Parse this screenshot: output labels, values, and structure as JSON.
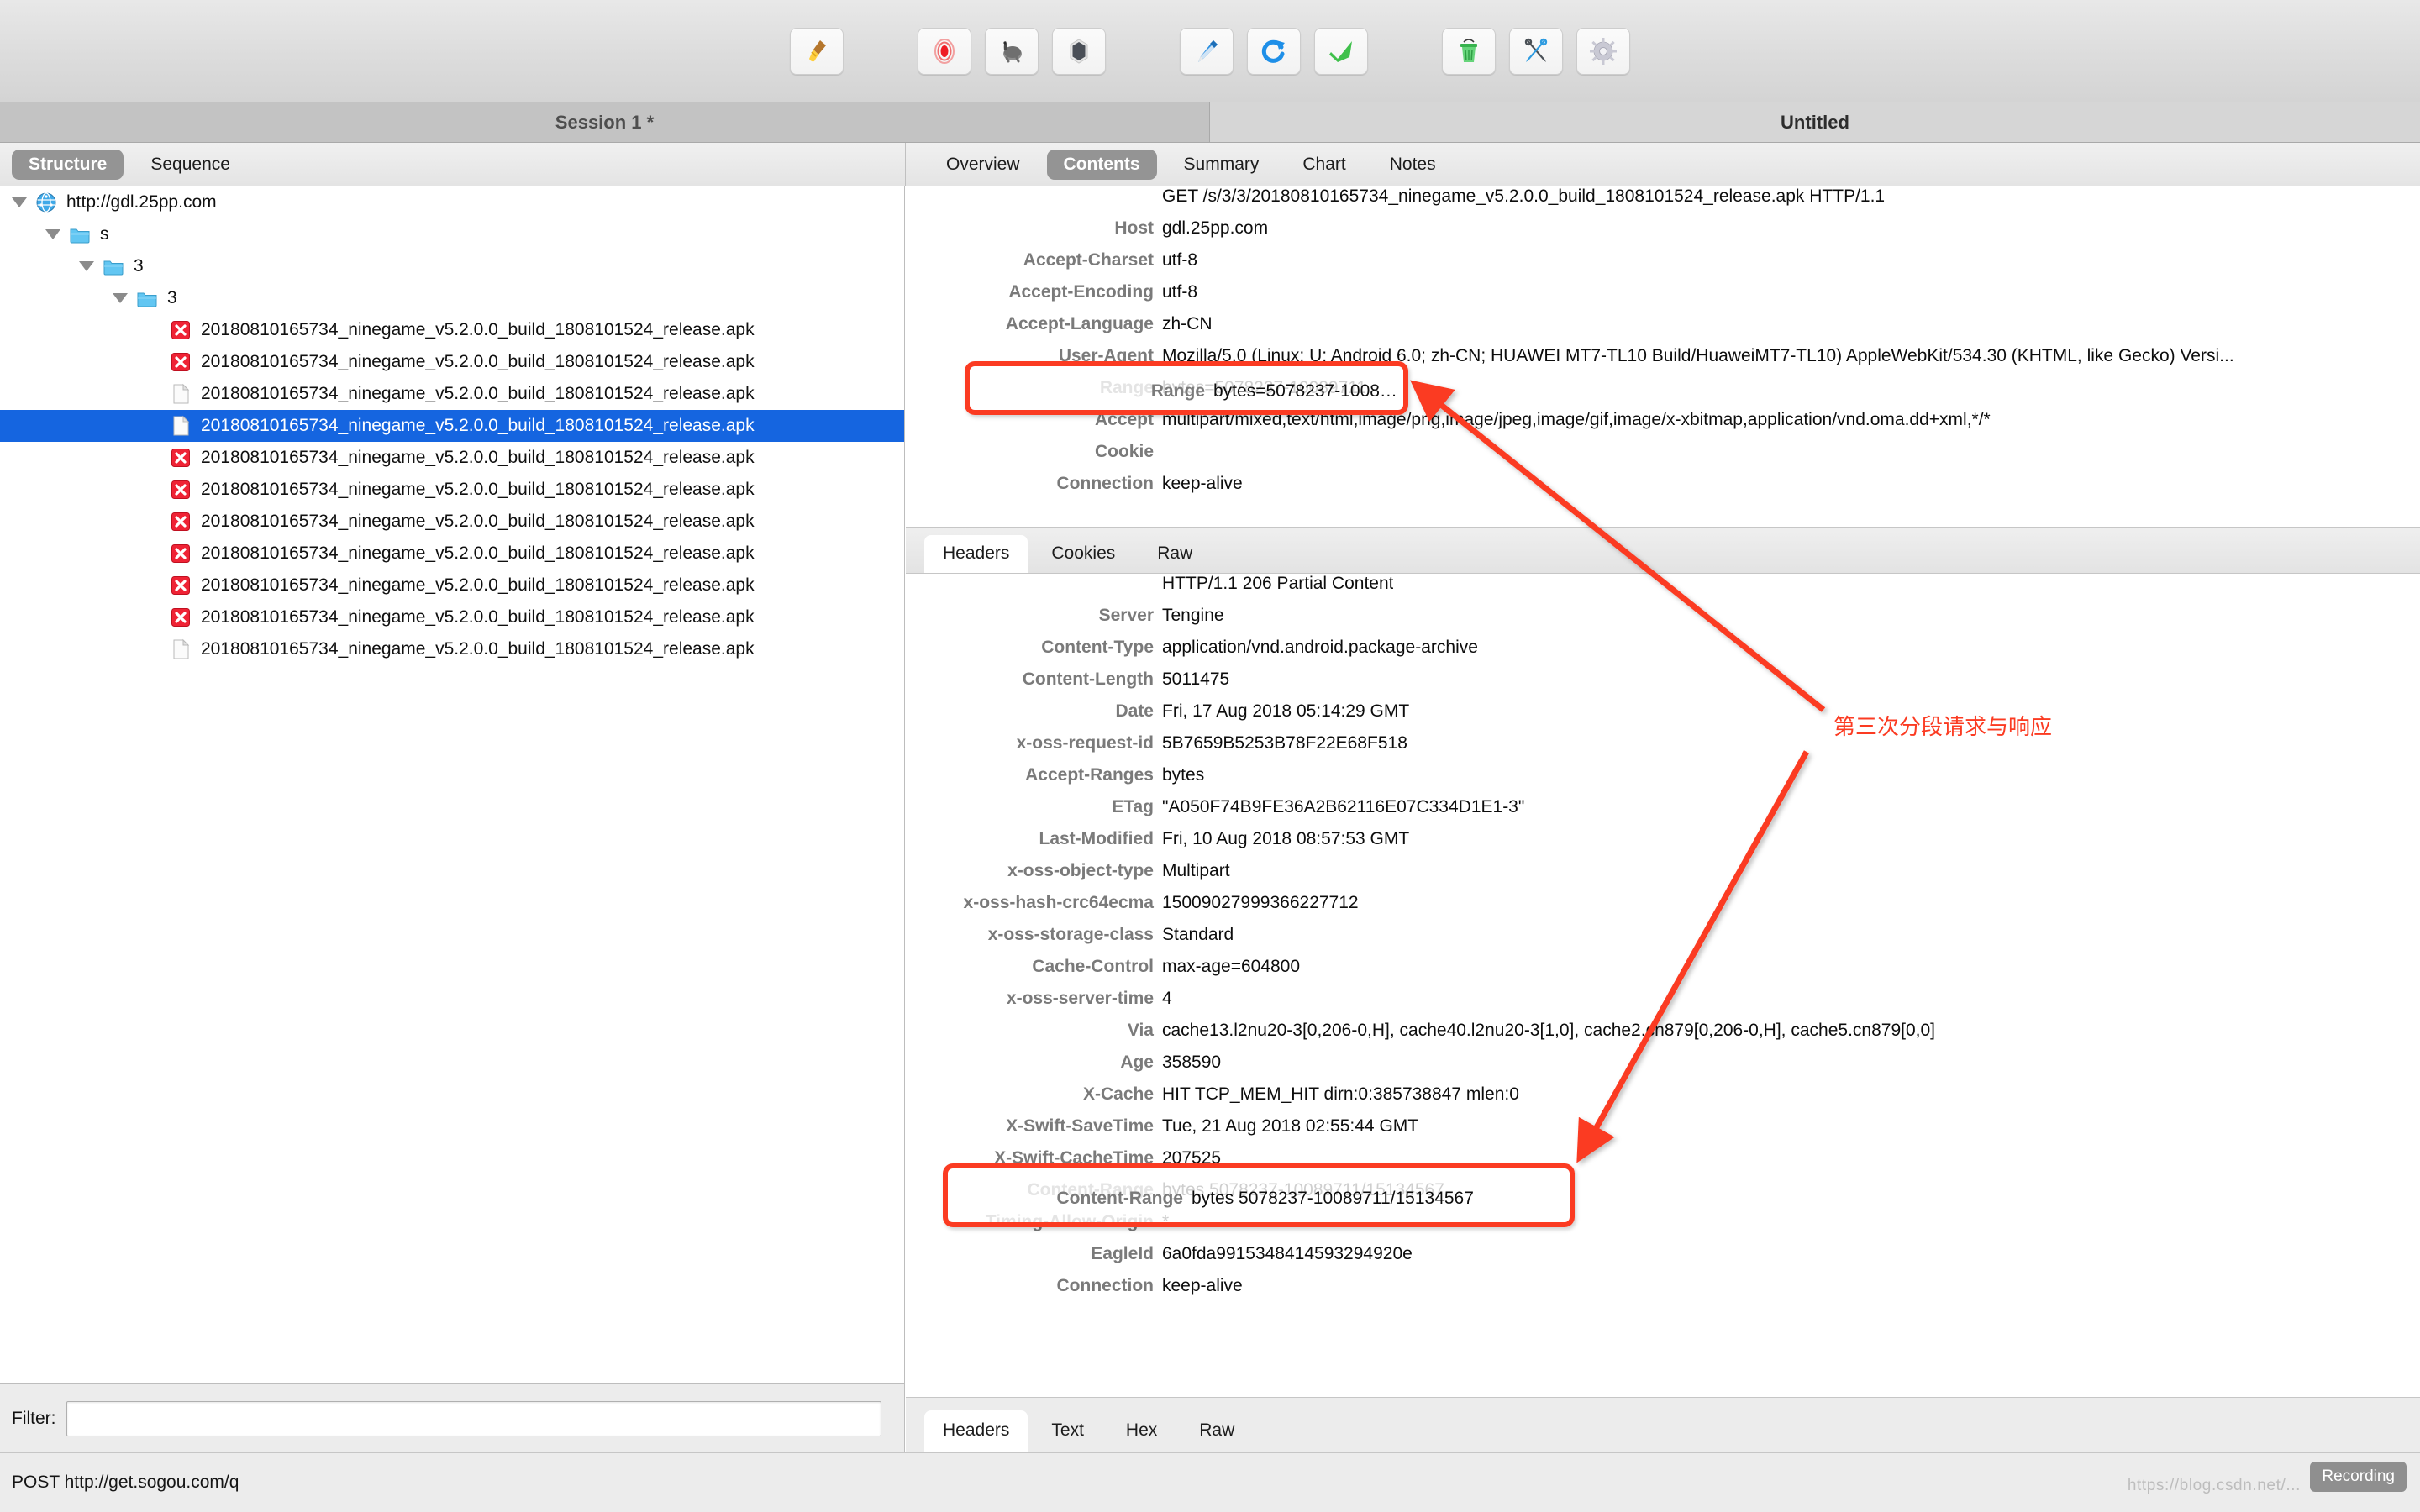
{
  "toolbar": {
    "buttons": [
      {
        "name": "clear-session-button",
        "icon": "broom-icon",
        "label": "Clear"
      },
      {
        "name": "record-button",
        "icon": "record-icon",
        "label": "Start/Stop Recording"
      },
      {
        "name": "throttle-button",
        "icon": "turtle-icon",
        "label": "Throttle"
      },
      {
        "name": "breakpoints-button",
        "icon": "shield-icon",
        "label": "Breakpoints"
      },
      {
        "name": "compose-button",
        "icon": "pen-icon",
        "label": "Compose"
      },
      {
        "name": "repeat-button",
        "icon": "repeat-icon",
        "label": "Repeat"
      },
      {
        "name": "validate-button",
        "icon": "checkmark-icon",
        "label": "Validate"
      },
      {
        "name": "trash-button",
        "icon": "trash-icon",
        "label": "Delete"
      },
      {
        "name": "tools-button",
        "icon": "tools-icon",
        "label": "Tools"
      },
      {
        "name": "settings-button",
        "icon": "gear-icon",
        "label": "Settings"
      }
    ]
  },
  "session": {
    "left_title": "Session 1 *",
    "right_title": "Untitled"
  },
  "left_tabs": [
    {
      "label": "Structure",
      "active": true
    },
    {
      "label": "Sequence",
      "active": false
    }
  ],
  "right_tabs": [
    {
      "label": "Overview",
      "active": false
    },
    {
      "label": "Contents",
      "active": true
    },
    {
      "label": "Summary",
      "active": false
    },
    {
      "label": "Chart",
      "active": false
    },
    {
      "label": "Notes",
      "active": false
    }
  ],
  "tree": {
    "apk_name": "20180810165734_ninegame_v5.2.0.0_build_1808101524_release.apk",
    "rows": [
      {
        "indent": 0,
        "twisty": true,
        "icon": "globe-icon",
        "label": "http://gdl.25pp.com",
        "selected": false
      },
      {
        "indent": 1,
        "twisty": true,
        "icon": "folder-icon",
        "label": "s",
        "selected": false
      },
      {
        "indent": 2,
        "twisty": true,
        "icon": "folder-icon",
        "label": "3",
        "selected": false
      },
      {
        "indent": 3,
        "twisty": true,
        "icon": "folder-icon",
        "label": "3",
        "selected": false
      },
      {
        "indent": 4,
        "twisty": false,
        "icon": "error-icon",
        "label": "20180810165734_ninegame_v5.2.0.0_build_1808101524_release.apk",
        "selected": false
      },
      {
        "indent": 4,
        "twisty": false,
        "icon": "error-icon",
        "label": "20180810165734_ninegame_v5.2.0.0_build_1808101524_release.apk",
        "selected": false
      },
      {
        "indent": 4,
        "twisty": false,
        "icon": "file-icon",
        "label": "20180810165734_ninegame_v5.2.0.0_build_1808101524_release.apk",
        "selected": false
      },
      {
        "indent": 4,
        "twisty": false,
        "icon": "file-icon",
        "label": "20180810165734_ninegame_v5.2.0.0_build_1808101524_release.apk",
        "selected": true
      },
      {
        "indent": 4,
        "twisty": false,
        "icon": "error-icon",
        "label": "20180810165734_ninegame_v5.2.0.0_build_1808101524_release.apk",
        "selected": false
      },
      {
        "indent": 4,
        "twisty": false,
        "icon": "error-icon",
        "label": "20180810165734_ninegame_v5.2.0.0_build_1808101524_release.apk",
        "selected": false
      },
      {
        "indent": 4,
        "twisty": false,
        "icon": "error-icon",
        "label": "20180810165734_ninegame_v5.2.0.0_build_1808101524_release.apk",
        "selected": false
      },
      {
        "indent": 4,
        "twisty": false,
        "icon": "error-icon",
        "label": "20180810165734_ninegame_v5.2.0.0_build_1808101524_release.apk",
        "selected": false
      },
      {
        "indent": 4,
        "twisty": false,
        "icon": "error-icon",
        "label": "20180810165734_ninegame_v5.2.0.0_build_1808101524_release.apk",
        "selected": false
      },
      {
        "indent": 4,
        "twisty": false,
        "icon": "error-icon",
        "label": "20180810165734_ninegame_v5.2.0.0_build_1808101524_release.apk",
        "selected": false
      },
      {
        "indent": 4,
        "twisty": false,
        "icon": "file-icon",
        "label": "20180810165734_ninegame_v5.2.0.0_build_1808101524_release.apk",
        "selected": false
      }
    ]
  },
  "filter": {
    "label": "Filter:",
    "value": "",
    "placeholder": ""
  },
  "request": {
    "request_line": "GET /s/3/3/20180810165734_ninegame_v5.2.0.0_build_1808101524_release.apk HTTP/1.1",
    "headers": [
      {
        "name": "Host",
        "value": "gdl.25pp.com"
      },
      {
        "name": "Accept-Charset",
        "value": "utf-8"
      },
      {
        "name": "Accept-Encoding",
        "value": "utf-8"
      },
      {
        "name": "Accept-Language",
        "value": "zh-CN"
      },
      {
        "name": "User-Agent",
        "value": "Mozilla/5.0 (Linux; U; Android 6.0; zh-CN; HUAWEI MT7-TL10 Build/HuaweiMT7-TL10) AppleWebKit/534.30 (KHTML, like Gecko) Versi..."
      },
      {
        "name": "Range",
        "value": "bytes=5078237-10089711"
      },
      {
        "name": "Accept",
        "value": "multipart/mixed,text/html,image/png,image/jpeg,image/gif,image/x-xbitmap,application/vnd.oma.dd+xml,*/*"
      },
      {
        "name": "Cookie",
        "value": ""
      },
      {
        "name": "Connection",
        "value": "keep-alive"
      }
    ]
  },
  "response_tabs": [
    {
      "label": "Headers",
      "active": true
    },
    {
      "label": "Cookies",
      "active": false
    },
    {
      "label": "Raw",
      "active": false
    }
  ],
  "response": {
    "status_line": "HTTP/1.1 206 Partial Content",
    "headers": [
      {
        "name": "Server",
        "value": "Tengine"
      },
      {
        "name": "Content-Type",
        "value": "application/vnd.android.package-archive"
      },
      {
        "name": "Content-Length",
        "value": "5011475"
      },
      {
        "name": "Date",
        "value": "Fri, 17 Aug 2018 05:14:29 GMT"
      },
      {
        "name": "x-oss-request-id",
        "value": "5B7659B5253B78F22E68F518"
      },
      {
        "name": "Accept-Ranges",
        "value": "bytes"
      },
      {
        "name": "ETag",
        "value": "\"A050F74B9FE36A2B62116E07C334D1E1-3\""
      },
      {
        "name": "Last-Modified",
        "value": "Fri, 10 Aug 2018 08:57:53 GMT"
      },
      {
        "name": "x-oss-object-type",
        "value": "Multipart"
      },
      {
        "name": "x-oss-hash-crc64ecma",
        "value": "15009027999366227712"
      },
      {
        "name": "x-oss-storage-class",
        "value": "Standard"
      },
      {
        "name": "Cache-Control",
        "value": "max-age=604800"
      },
      {
        "name": "x-oss-server-time",
        "value": "4"
      },
      {
        "name": "Via",
        "value": "cache13.l2nu20-3[0,206-0,H], cache40.l2nu20-3[1,0], cache2.cn879[0,206-0,H], cache5.cn879[0,0]"
      },
      {
        "name": "Age",
        "value": "358590"
      },
      {
        "name": "X-Cache",
        "value": "HIT TCP_MEM_HIT dirn:0:385738847 mlen:0"
      },
      {
        "name": "X-Swift-SaveTime",
        "value": "Tue, 21 Aug 2018 02:55:44 GMT"
      },
      {
        "name": "X-Swift-CacheTime",
        "value": "207525"
      },
      {
        "name": "Content-Range",
        "value": "bytes 5078237-10089711/15134567"
      },
      {
        "name": "Timing-Allow-Origin",
        "value": "*"
      },
      {
        "name": "EagleId",
        "value": "6a0fda9915348414593294920e"
      },
      {
        "name": "Connection",
        "value": "keep-alive"
      }
    ]
  },
  "bottom_tabs": [
    {
      "label": "Headers",
      "active": true
    },
    {
      "label": "Text",
      "active": false
    },
    {
      "label": "Hex",
      "active": false
    },
    {
      "label": "Raw",
      "active": false
    }
  ],
  "status": {
    "text": "POST http://get.sogou.com/q",
    "recording": "Recording",
    "watermark": "https://blog.csdn.net/..."
  },
  "annotations": {
    "note_text": "第三次分段请求与响应",
    "note_color": "#fb3b22",
    "boxed_request_header": {
      "name": "Range",
      "value": "bytes=5078237-10089711"
    },
    "boxed_response_header": {
      "name": "Content-Range",
      "value": "bytes 5078237-10089711/15134567"
    }
  }
}
